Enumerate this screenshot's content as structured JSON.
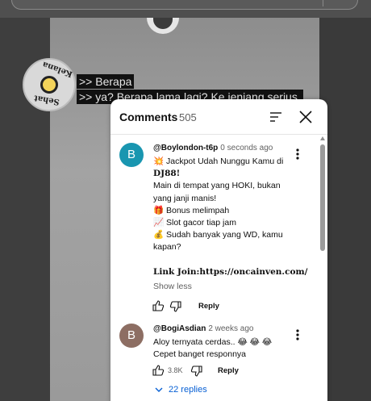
{
  "video": {
    "channel_logo_text_top": "Kelana",
    "channel_logo_text_bottom": "Sehat"
  },
  "captions": [
    ">> Berapa",
    ">> ya? Berapa lama lagi? Ke jenjang serius."
  ],
  "comments_panel": {
    "title": "Comments",
    "count": "505",
    "sort_icon": "sort-icon",
    "close_icon": "close-icon",
    "comments": [
      {
        "avatar_letter": "B",
        "avatar_color": "#1996b0",
        "author": "@Boylondon-t6p",
        "time": "0 seconds ago",
        "lines": [
          "💥 Jackpot Udah Nunggu Kamu di",
          "DJ88!",
          "Main di tempat yang HOKI, bukan",
          "yang janji manis!",
          "🎁 Bonus melimpah",
          "📈 Slot gacor tiap jam",
          "💰 Sudah banyak yang WD, kamu",
          "kapan?",
          "",
          "Link Join:https://oncainven.com/"
        ],
        "show_less": "Show less",
        "reply_label": "Reply"
      },
      {
        "avatar_letter": "B",
        "avatar_color": "#8d6e63",
        "author": "@BogiAsdian",
        "time": "2 weeks ago",
        "lines": [
          "Aloy ternyata cerdas.. 😂 😂 😂",
          "Cepet banget responnya"
        ],
        "like_count": "3.8K",
        "reply_label": "Reply",
        "replies_label": "22 replies"
      }
    ]
  }
}
